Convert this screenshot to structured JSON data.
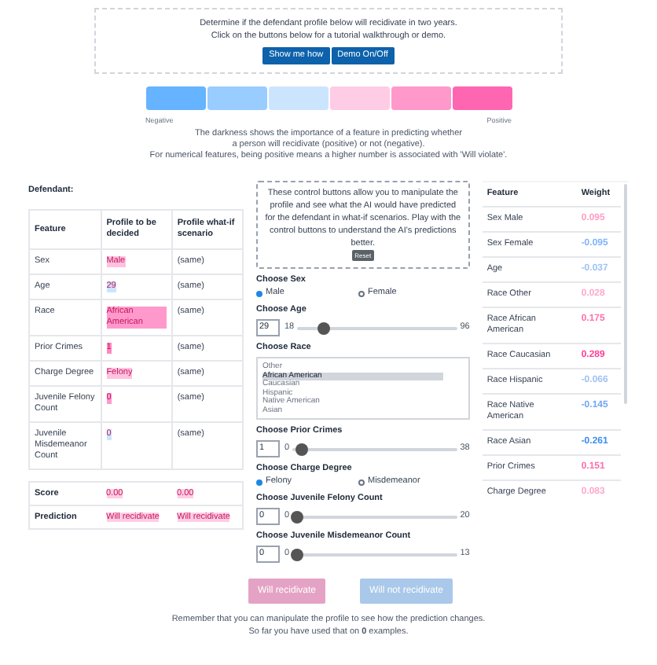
{
  "intro": {
    "lines": [
      "Determine if the defendant profile below will recidivate in two years.",
      "Click on the buttons below for a tutorial walkthrough or demo."
    ],
    "buttons": [
      "Show me how",
      "Demo On/Off"
    ]
  },
  "legend": {
    "swatches": [
      {
        "color": "#66b3ff"
      },
      {
        "color": "#99ccff"
      },
      {
        "color": "#cce5ff"
      },
      {
        "color": "#ffcce5"
      },
      {
        "color": "#ff99cc"
      },
      {
        "color": "#ff66b2"
      }
    ],
    "negative_label": "Negative",
    "positive_label": "Positive",
    "description": [
      "The darkness shows the importance of a feature in predicting whether",
      "a person will recidivate (positive) or not (negative).",
      "For numerical features, being positive means a higher number is associated with 'Will violate'."
    ]
  },
  "defendant": {
    "title": "Defendant:",
    "columns": [
      "Feature",
      "Profile to be decided",
      "Profile what-if scenario"
    ],
    "rows": [
      {
        "feature": "Sex",
        "profile": {
          "text": "Male",
          "color": "#ffc2e0"
        },
        "whatif": "(same)"
      },
      {
        "feature": "Age",
        "profile": {
          "text": "29",
          "color": "#cce5ff"
        },
        "whatif": "(same)"
      },
      {
        "feature": "Race",
        "profile": {
          "text": "African American",
          "color": "#ff99cc"
        },
        "whatif": "(same)"
      },
      {
        "feature": "Prior Crimes",
        "profile": {
          "text": "1",
          "color": "#ff88c0"
        },
        "whatif": "(same)"
      },
      {
        "feature": "Charge Degree",
        "profile": {
          "text": "Felony",
          "color": "#ffc2e0"
        },
        "whatif": "(same)"
      },
      {
        "feature": "Juvenile Felony Count",
        "profile": {
          "text": "0",
          "color": "#ff99cc"
        },
        "whatif": "(same)"
      },
      {
        "feature": "Juvenile Misdemeanor Count",
        "profile": {
          "text": "0",
          "color": "#cce5ff"
        },
        "whatif": "(same)"
      }
    ],
    "summary": [
      {
        "label": "Score",
        "profile": "0.00",
        "whatif": "0.00",
        "color": "#ffcce5"
      },
      {
        "label": "Prediction",
        "profile": "Will recidivate",
        "whatif": "Will recidivate",
        "color": "#ffcce5"
      }
    ]
  },
  "controls": {
    "intro": "These control buttons allow you to manipulate the profile and see what the AI would have predicted for the defendant in what-if scenarios. Play with the control buttons to understand the AI's predictions better.",
    "reset": "Reset",
    "sections": [
      {
        "kind": "radio",
        "label": "Choose Sex",
        "options": [
          {
            "label": "Male",
            "selected": true
          },
          {
            "label": "Female",
            "selected": false
          }
        ]
      },
      {
        "kind": "slider",
        "label": "Choose Age",
        "value": "29",
        "min": "18",
        "max": "96",
        "level": 0.14
      },
      {
        "kind": "list",
        "label": "Choose Race",
        "options": [
          {
            "label": "Other",
            "selected": false
          },
          {
            "label": "African American",
            "selected": true
          },
          {
            "label": "Caucasian",
            "selected": false
          },
          {
            "label": "Hispanic",
            "selected": false
          },
          {
            "label": "Native American",
            "selected": false
          },
          {
            "label": "Asian",
            "selected": false
          }
        ]
      },
      {
        "kind": "slider",
        "label": "Choose Prior Crimes",
        "value": "1",
        "min": "0",
        "max": "38",
        "level": 0.03
      },
      {
        "kind": "radio",
        "label": "Choose Charge Degree",
        "options": [
          {
            "label": "Felony",
            "selected": true
          },
          {
            "label": "Misdemeanor",
            "selected": false
          }
        ]
      },
      {
        "kind": "slider",
        "label": "Choose Juvenile Felony Count",
        "value": "0",
        "min": "0",
        "max": "20",
        "level": 0
      },
      {
        "kind": "slider",
        "label": "Choose Juvenile Misdemeanor Count",
        "value": "0",
        "min": "0",
        "max": "13",
        "level": 0
      }
    ]
  },
  "weights": {
    "columns": [
      "Feature",
      "Weight"
    ],
    "rows": [
      {
        "feature": "Sex Male",
        "weight": "0.095",
        "color": "#ff9ec4"
      },
      {
        "feature": "Sex Female",
        "weight": "-0.095",
        "color": "#7fb4ff"
      },
      {
        "feature": "Age",
        "weight": "-0.037",
        "color": "#9fc2f5"
      },
      {
        "feature": "Race Other",
        "weight": "0.028",
        "color": "#ffa8cb"
      },
      {
        "feature": "Race African American",
        "weight": "0.175",
        "color": "#ff6fae"
      },
      {
        "feature": "Race Caucasian",
        "weight": "0.289",
        "color": "#ff3d96"
      },
      {
        "feature": "Race Hispanic",
        "weight": "-0.066",
        "color": "#9fc2f5"
      },
      {
        "feature": "Race Native American",
        "weight": "-0.145",
        "color": "#6fa8f0"
      },
      {
        "feature": "Race Asian",
        "weight": "-0.261",
        "color": "#3b8cf0"
      },
      {
        "feature": "Prior Crimes",
        "weight": "0.151",
        "color": "#ff6fae"
      },
      {
        "feature": "Charge Degree",
        "weight": "0.083",
        "color": "#ffa8cb"
      }
    ]
  },
  "actions": [
    {
      "label": "Will recidivate",
      "color": "#e4a3c4"
    },
    {
      "label": "Will not recidivate",
      "color": "#a9c8ea"
    }
  ],
  "footer": [
    "Remember that you can manipulate the profile to see how the prediction changes.",
    "So far you have used that on **0** examples."
  ]
}
